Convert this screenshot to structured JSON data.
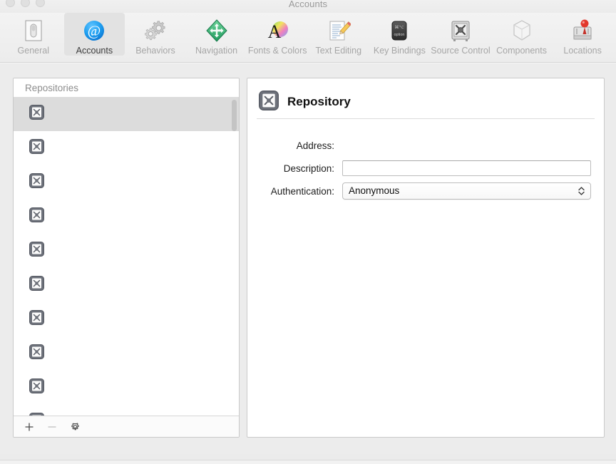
{
  "window": {
    "title": "Accounts",
    "traffic_lights": [
      "close-button",
      "minimize-button",
      "zoom-button"
    ]
  },
  "toolbar": {
    "tabs": [
      {
        "label": "General",
        "icon": "general-switch-icon",
        "selected": false
      },
      {
        "label": "Accounts",
        "icon": "at-sign-icon",
        "selected": true
      },
      {
        "label": "Behaviors",
        "icon": "gears-icon",
        "selected": false
      },
      {
        "label": "Navigation",
        "icon": "green-diamond-arrows-icon",
        "selected": false
      },
      {
        "label": "Fonts & Colors",
        "icon": "letter-a-color-wheel-icon",
        "selected": false
      },
      {
        "label": "Text Editing",
        "icon": "document-pencil-icon",
        "selected": false
      },
      {
        "label": "Key Bindings",
        "icon": "keyboard-key-icon",
        "selected": false
      },
      {
        "label": "Source Control",
        "icon": "safe-vault-icon",
        "selected": false
      },
      {
        "label": "Components",
        "icon": "hexagon-box-icon",
        "selected": false
      },
      {
        "label": "Locations",
        "icon": "hard-drive-pin-icon",
        "selected": false
      }
    ]
  },
  "sidebar": {
    "header": "Repositories",
    "rows": [
      {
        "icon": "repository-icon",
        "label": "",
        "selected": true
      },
      {
        "icon": "repository-icon",
        "label": "",
        "selected": false
      },
      {
        "icon": "repository-icon",
        "label": "",
        "selected": false
      },
      {
        "icon": "repository-icon",
        "label": "",
        "selected": false
      },
      {
        "icon": "repository-icon",
        "label": "",
        "selected": false
      },
      {
        "icon": "repository-icon",
        "label": "",
        "selected": false
      },
      {
        "icon": "repository-icon",
        "label": "",
        "selected": false
      },
      {
        "icon": "repository-icon",
        "label": "",
        "selected": false
      },
      {
        "icon": "repository-icon",
        "label": "",
        "selected": false
      },
      {
        "icon": "repository-icon",
        "label": "",
        "selected": false
      }
    ],
    "footer": {
      "add_label": "+",
      "remove_label": "−",
      "settings_icon": "gear-icon"
    }
  },
  "detail": {
    "icon": "repository-icon",
    "title": "Repository",
    "fields": {
      "address_label": "Address:",
      "address_value": "",
      "description_label": "Description:",
      "description_value": "",
      "description_placeholder": "",
      "authentication_label": "Authentication:",
      "authentication_value": "Anonymous",
      "authentication_options": [
        "Anonymous"
      ]
    }
  },
  "colors": {
    "selection": "#dcdcdc",
    "toolbar_selected": "#e2e2e2",
    "panel_border": "#c9c9c9",
    "label_text": "#1d1d1d",
    "muted_text": "#a6a6a6"
  }
}
